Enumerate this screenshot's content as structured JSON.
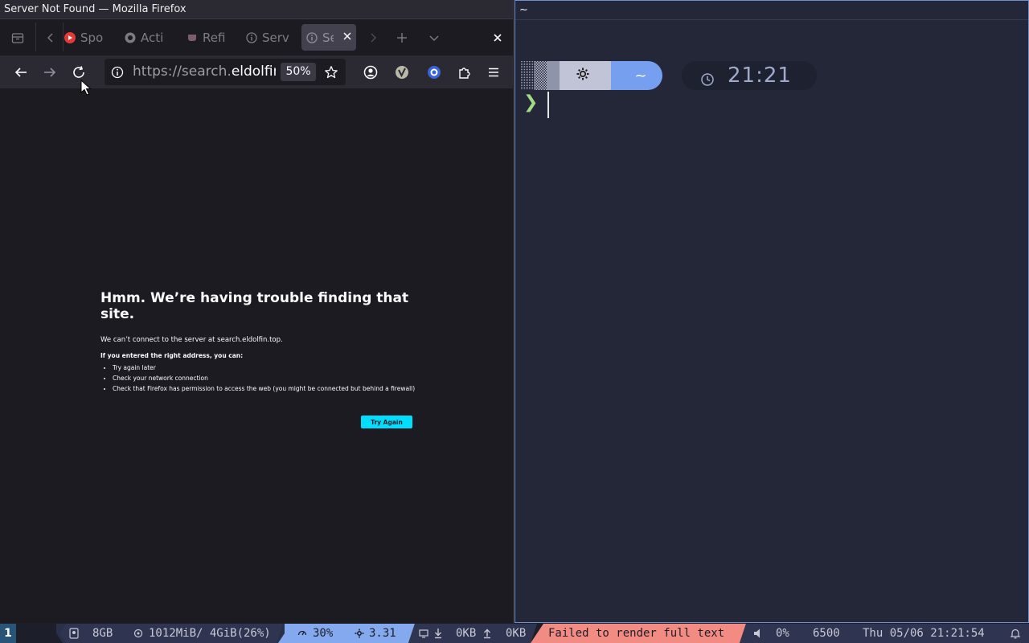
{
  "firefox": {
    "window_title": "Server Not Found — Mozilla Firefox",
    "tabs": [
      {
        "label": "Spo"
      },
      {
        "label": "Acti"
      },
      {
        "label": "Refi"
      },
      {
        "label": "Serv"
      },
      {
        "label": "Se",
        "active": true
      }
    ],
    "url": {
      "prefix": "https://search.",
      "host": "eldolfir"
    },
    "zoom": "50%",
    "error": {
      "title": "Hmm. We’re having trouble finding that site.",
      "description": "We can’t connect to the server at search.eldolfin.top.",
      "lead": "If you entered the right address, you can:",
      "suggestions": [
        "Try again later",
        "Check your network connection",
        "Check that Firefox has permission to access the web (you might be connected but behind a firewall)"
      ],
      "button": "Try Again"
    }
  },
  "terminal": {
    "window_title": "~",
    "prompt_dir": "~",
    "prompt_time": "21:21",
    "prompt_symbol": "❯"
  },
  "statusbar": {
    "workspace": "1",
    "disk": "8GB",
    "memory": "1012MiB/ 4GiB(26%)",
    "cpu": "30%",
    "load": "3.31",
    "net_down": "0KB",
    "net_up": "0KB",
    "error_text": "Failed to render full text",
    "volume": "0%",
    "color_temp": "6500",
    "datetime": "Thu 05/06 21:21:54"
  },
  "colors": {
    "firefox_bg": "#1c1b22",
    "firefox_toolbar": "#2b2a33",
    "accent_button": "#00ddff",
    "terminal_bg": "#232738",
    "prompt_blue": "#769ff0",
    "prompt_green": "#a3d982",
    "statusbar_red": "#f28b82",
    "statusbar_blue": "#84a9ef",
    "workspace": "#285577"
  }
}
